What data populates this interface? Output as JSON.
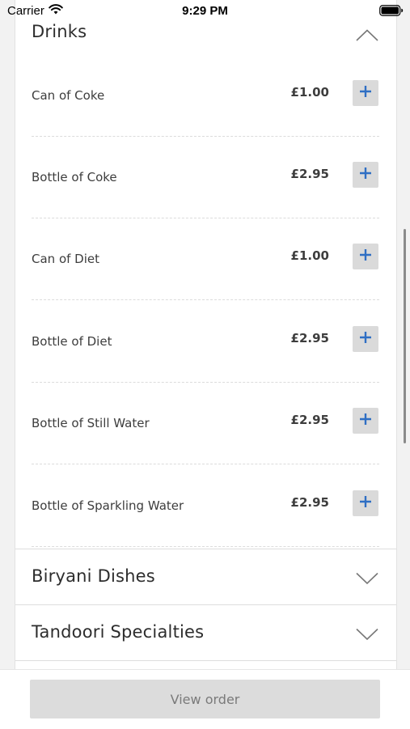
{
  "status_bar": {
    "carrier": "Carrier",
    "time": "9:29 PM",
    "wifi_icon": "wifi-icon",
    "battery_icon": "battery-icon"
  },
  "sections": [
    {
      "title": "Drinks",
      "expanded": true,
      "chevron_icon": "chevron-up-icon",
      "items": [
        {
          "name": "Can of Coke",
          "price": "£1.00",
          "action_icon": "plus-icon"
        },
        {
          "name": "Bottle of Coke",
          "price": "£2.95",
          "action_icon": "plus-icon"
        },
        {
          "name": "Can of Diet",
          "price": "£1.00",
          "action_icon": "plus-icon"
        },
        {
          "name": "Bottle of Diet",
          "price": "£2.95",
          "action_icon": "plus-icon"
        },
        {
          "name": "Bottle of Still Water",
          "price": "£2.95",
          "action_icon": "plus-icon"
        },
        {
          "name": "Bottle of Sparkling Water",
          "price": "£2.95",
          "action_icon": "plus-icon"
        }
      ]
    },
    {
      "title": "Biryani Dishes",
      "expanded": false,
      "chevron_icon": "chevron-down-icon"
    },
    {
      "title": "Tandoori Specialties",
      "expanded": false,
      "chevron_icon": "chevron-down-icon"
    }
  ],
  "footer": {
    "view_order_label": "View order"
  },
  "colors": {
    "accent": "#2f6fc4",
    "button_bg": "#dadada",
    "background": "#f2f2f2"
  }
}
